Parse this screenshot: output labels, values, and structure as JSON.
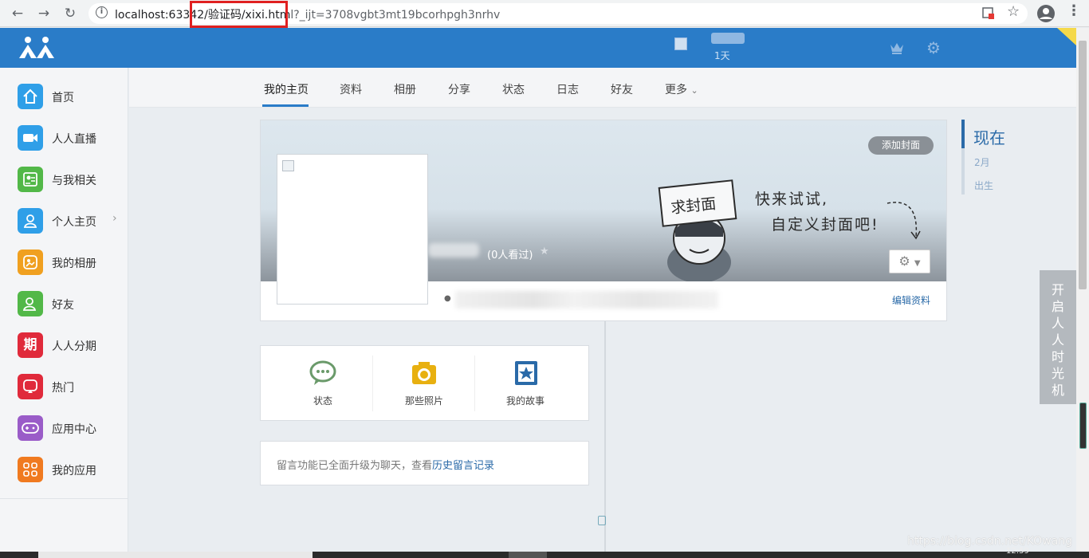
{
  "browser": {
    "url_host": "localhost:6334",
    "url_path": "2/验证码/xixi.htm",
    "url_query": "l?_ijt=3708vgbt3mt19bcorhpgh3nrhv"
  },
  "topbar": {
    "days_label": "1天"
  },
  "sidebar": {
    "items": [
      {
        "label": "首页",
        "icon": "home-icon",
        "color": "#2f9fe8"
      },
      {
        "label": "人人直播",
        "icon": "video-icon",
        "color": "#2f9fe8"
      },
      {
        "label": "与我相关",
        "icon": "contact-card-icon",
        "color": "#52b848"
      },
      {
        "label": "个人主页",
        "icon": "person-icon",
        "color": "#2f9fe8"
      },
      {
        "label": "我的相册",
        "icon": "album-icon",
        "color": "#f0a020"
      },
      {
        "label": "好友",
        "icon": "friend-icon",
        "color": "#52b848"
      },
      {
        "label": "人人分期",
        "icon": "installment-icon",
        "color": "#e02a3b",
        "glyph": "期"
      },
      {
        "label": "热门",
        "icon": "hot-icon",
        "color": "#e02a3b"
      },
      {
        "label": "应用中心",
        "icon": "gamepad-icon",
        "color": "#9a5cc8"
      },
      {
        "label": "我的应用",
        "icon": "apps-grid-icon",
        "color": "#f07a20"
      }
    ]
  },
  "tabs": [
    "我的主页",
    "资料",
    "相册",
    "分享",
    "状态",
    "日志",
    "好友",
    "更多"
  ],
  "cover": {
    "add_cover": "添加封面",
    "sign_text": "求封面",
    "slogan_line1": "快来试试,",
    "slogan_line2": "自定义封面吧!",
    "views": "(0人看过)",
    "edit_profile": "编辑资料"
  },
  "actions": [
    {
      "label": "状态",
      "icon": "chat-bubble-icon",
      "color": "#6a9a6a"
    },
    {
      "label": "那些照片",
      "icon": "camera-icon",
      "color": "#e8b010"
    },
    {
      "label": "我的故事",
      "icon": "story-book-icon",
      "color": "#2a6aa8"
    }
  ],
  "message_notice": {
    "text": "留言功能已全面升级为聊天，查看",
    "link": "历史留言记录"
  },
  "timeline": {
    "now": "现在",
    "items": [
      "2月",
      "出生"
    ]
  },
  "time_machine": "开启人人时光机",
  "watermark": "https://blog.csdn.net/KOwang",
  "clock": "12:59"
}
